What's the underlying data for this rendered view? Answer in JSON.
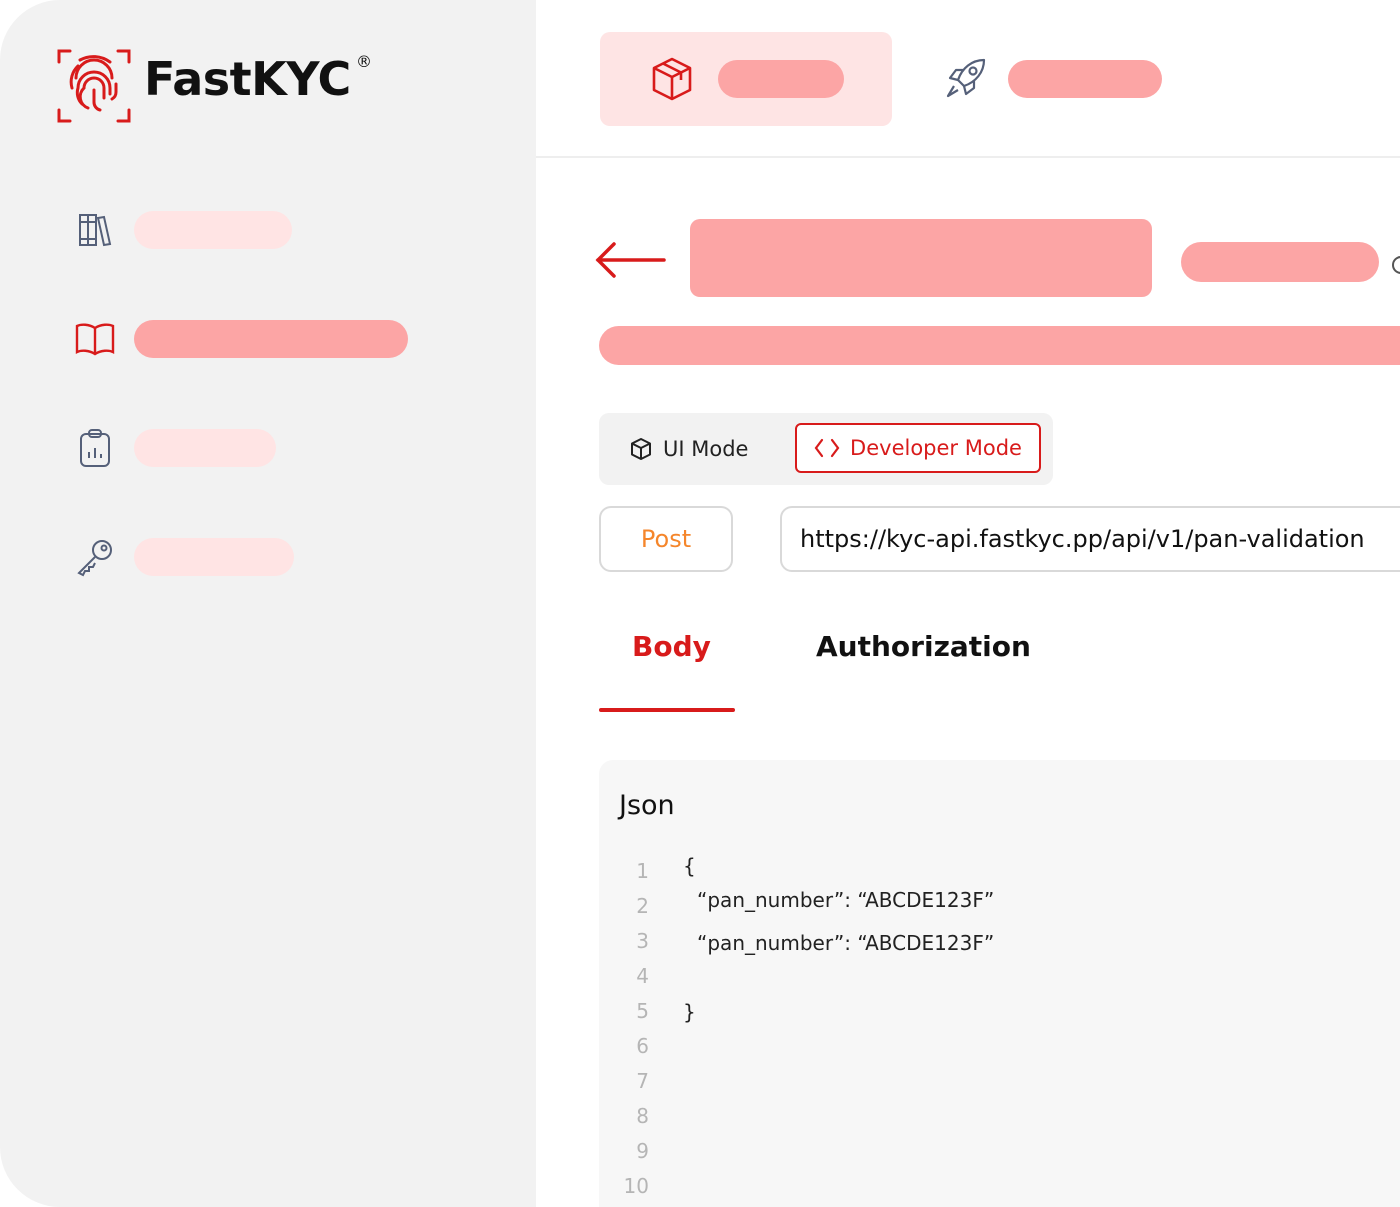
{
  "brand": {
    "name": "FastKYC",
    "registered": "®",
    "color": "#d81b1b"
  },
  "sidebar": {
    "items": [
      {
        "icon": "library-icon",
        "active": false
      },
      {
        "icon": "open-book-icon",
        "active": true
      },
      {
        "icon": "clipboard-chart-icon",
        "active": false
      },
      {
        "icon": "key-icon",
        "active": false
      }
    ]
  },
  "topnav": {
    "tabs": [
      {
        "icon": "cube-icon",
        "active": true
      },
      {
        "icon": "rocket-icon",
        "active": false
      }
    ]
  },
  "mode_toggle": {
    "ui_label": "UI Mode",
    "dev_label": "Developer Mode",
    "selected": "Developer Mode"
  },
  "request": {
    "method": "Post",
    "url": "https://kyc-api.fastkyc.pp/api/v1/pan-validation"
  },
  "tabs": {
    "body": "Body",
    "authorization": "Authorization",
    "active": "Body"
  },
  "json_panel": {
    "title": "Json",
    "line_numbers": [
      "1",
      "2",
      "3",
      "4",
      "5",
      "6",
      "7",
      "8",
      "9",
      "10"
    ],
    "code": {
      "open": "{",
      "line1": "“pan_number”: “ABCDE123F”",
      "line2": "“pan_number”: “ABCDE123F”",
      "close": "}"
    }
  },
  "colors": {
    "accent": "#d81b1b",
    "placeholder": "#fca5a5",
    "placeholder_light": "#ffe4e4",
    "method": "#f5862b"
  }
}
